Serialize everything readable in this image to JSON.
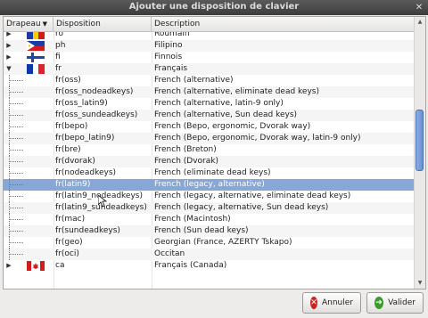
{
  "window": {
    "title": "Ajouter une disposition de clavier"
  },
  "columns": {
    "flag": "Drapeau",
    "layout": "Disposition",
    "description": "Description"
  },
  "rows": [
    {
      "layout": "ro",
      "description": "Roumain",
      "flag": "ro",
      "expander": "collapsed"
    },
    {
      "layout": "ph",
      "description": "Filipino",
      "flag": "ph",
      "expander": "collapsed"
    },
    {
      "layout": "fi",
      "description": "Finnois",
      "flag": "fi",
      "expander": "collapsed"
    },
    {
      "layout": "fr",
      "description": "Français",
      "flag": "fr",
      "expander": "expanded"
    },
    {
      "layout": "fr(oss)",
      "description": "French (alternative)"
    },
    {
      "layout": "fr(oss_nodeadkeys)",
      "description": "French (alternative, eliminate dead keys)"
    },
    {
      "layout": "fr(oss_latin9)",
      "description": "French (alternative, latin-9 only)"
    },
    {
      "layout": "fr(oss_sundeadkeys)",
      "description": "French (alternative, Sun dead keys)"
    },
    {
      "layout": "fr(bepo)",
      "description": "French (Bepo, ergonomic, Dvorak way)"
    },
    {
      "layout": "fr(bepo_latin9)",
      "description": "French (Bepo, ergonomic, Dvorak way, latin-9 only)"
    },
    {
      "layout": "fr(bre)",
      "description": "French (Breton)"
    },
    {
      "layout": "fr(dvorak)",
      "description": "French (Dvorak)"
    },
    {
      "layout": "fr(nodeadkeys)",
      "description": "French (eliminate dead keys)"
    },
    {
      "layout": "fr(latin9)",
      "description": "French (legacy, alternative)",
      "selected": true
    },
    {
      "layout": "fr(latin9_nodeadkeys)",
      "description": "French (legacy, alternative, eliminate dead keys)"
    },
    {
      "layout": "fr(latin9_sundeadkeys)",
      "description": "French (legacy, alternative, Sun dead keys)"
    },
    {
      "layout": "fr(mac)",
      "description": "French (Macintosh)"
    },
    {
      "layout": "fr(sundeadkeys)",
      "description": "French (Sun dead keys)"
    },
    {
      "layout": "fr(geo)",
      "description": "Georgian (France, AZERTY Tskapo)"
    },
    {
      "layout": "fr(oci)",
      "description": "Occitan"
    },
    {
      "layout": "ca",
      "description": "Français (Canada)",
      "flag": "ca",
      "expander": "collapsed"
    }
  ],
  "buttons": {
    "cancel": "Annuler",
    "ok": "Valider"
  },
  "colors": {
    "selection": "#87a7d6",
    "scroll_thumb": "#6b8fd0"
  }
}
